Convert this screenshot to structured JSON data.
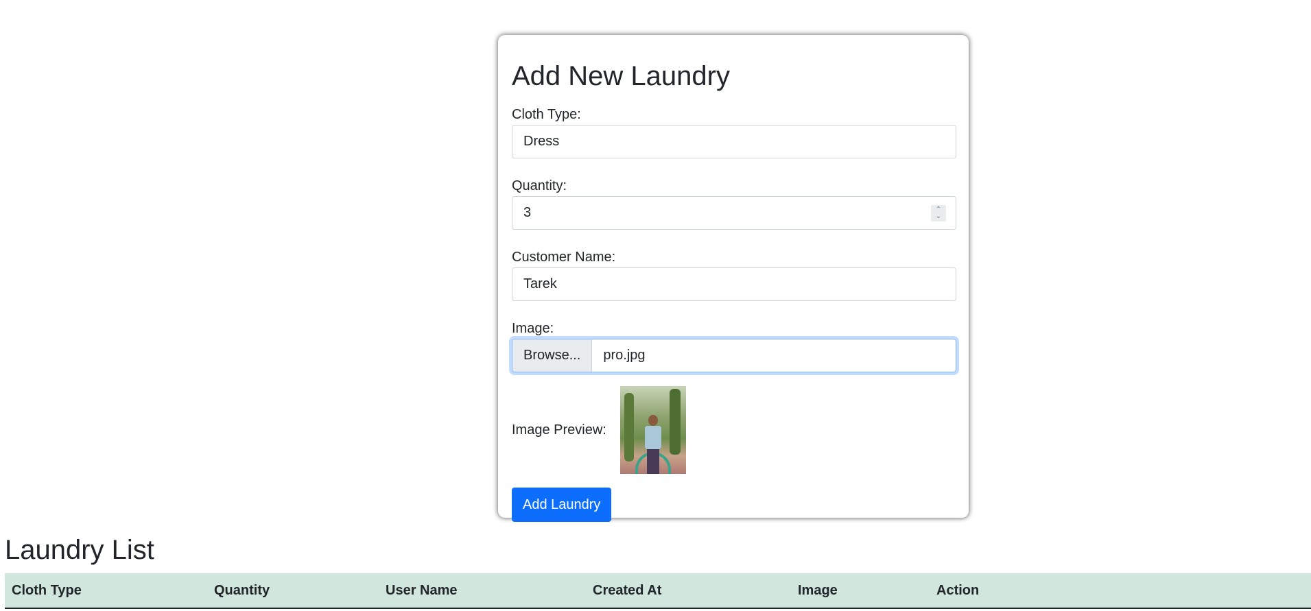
{
  "form": {
    "title": "Add New Laundry",
    "cloth_type": {
      "label": "Cloth Type:",
      "value": "Dress"
    },
    "quantity": {
      "label": "Quantity:",
      "value": "3"
    },
    "customer_name": {
      "label": "Customer Name:",
      "value": "Tarek"
    },
    "image": {
      "label": "Image:",
      "browse_label": "Browse...",
      "file_name": "pro.jpg"
    },
    "preview": {
      "label": "Image Preview:"
    },
    "submit_label": "Add Laundry"
  },
  "list": {
    "title": "Laundry List",
    "columns": [
      "Cloth Type",
      "Quantity",
      "User Name",
      "Created At",
      "Image",
      "Action"
    ]
  },
  "colors": {
    "primary": "#0d6efd",
    "table_header_bg": "#d1e7dd"
  }
}
